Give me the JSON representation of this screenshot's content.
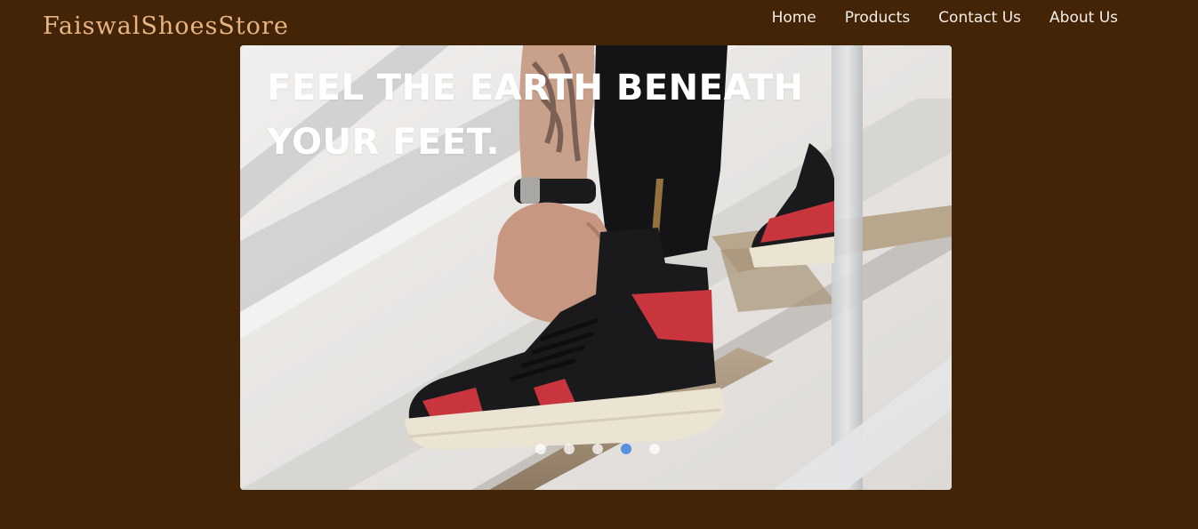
{
  "header": {
    "brand": "FaiswalShoesStore",
    "nav": [
      {
        "label": "Home"
      },
      {
        "label": "Products"
      },
      {
        "label": "Contact Us"
      },
      {
        "label": "About Us"
      }
    ]
  },
  "carousel": {
    "caption": "FEEL THE EARTH BENEATH YOUR FEET.",
    "slide_count": 5,
    "active_index": 3
  },
  "colors": {
    "background": "#432406",
    "brand_text": "#e8b483",
    "nav_text": "#f3eee8",
    "active_indicator": "#5b8fe0"
  }
}
